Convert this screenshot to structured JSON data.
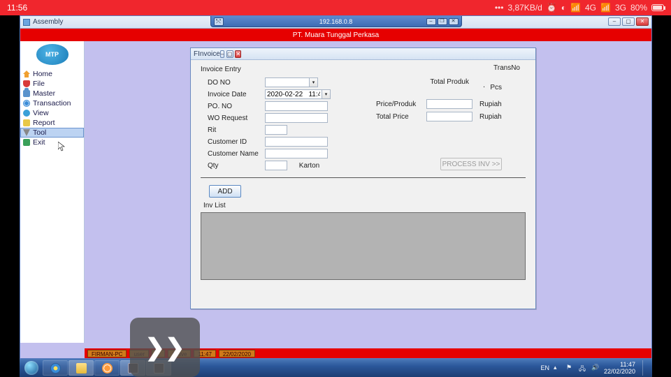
{
  "android": {
    "time": "11:56",
    "net_speed": "3,87KB/d",
    "signal1": "4G",
    "signal2": "3G",
    "battery": "80%"
  },
  "connection": {
    "host": "192.168.0.8"
  },
  "assembly": {
    "title": "Assembly"
  },
  "company_banner": "PT. Muara Tunggal Perkasa",
  "nav": {
    "home": "Home",
    "file": "File",
    "master": "Master",
    "transaction": "Transaction",
    "view": "View",
    "report": "Report",
    "tool": "Tool",
    "exit": "Exit"
  },
  "child": {
    "title": "FInvoice",
    "section": "Invoice Entry",
    "labels": {
      "do_no": "DO NO",
      "invoice_date": "Invoice Date",
      "po_no": "PO. NO",
      "wo_request": "WO Request",
      "rit": "Rit",
      "customer_id": "Customer ID",
      "customer_name": "Customer Name",
      "qty": "Qty",
      "qty_unit": "Karton",
      "price_produk": "Price/Produk",
      "total_price": "Total Price",
      "rupiah": "Rupiah",
      "transno": "TransNo",
      "total_produk": "Total Produk",
      "pcs": "Pcs"
    },
    "values": {
      "do_no": "",
      "invoice_date": "2020-02-22   11:4",
      "po_no": "",
      "wo_request": "",
      "rit": "",
      "customer_id": "",
      "customer_name": "",
      "qty": "",
      "price_produk": "",
      "total_price": "",
      "total_produk": "."
    },
    "buttons": {
      "process": "PROCESS INV >>",
      "add": "ADD"
    },
    "inv_list_label": "Inv List"
  },
  "mdi_footer": {
    "c1": "FIRMAN-PC",
    "c2": "user",
    "c3": "...",
    "c4": "Active",
    "c5": "11:47",
    "c6": "22/02/2020"
  },
  "taskbar": {
    "lang": "EN",
    "time": "11:47",
    "date": "22/02/2020"
  }
}
